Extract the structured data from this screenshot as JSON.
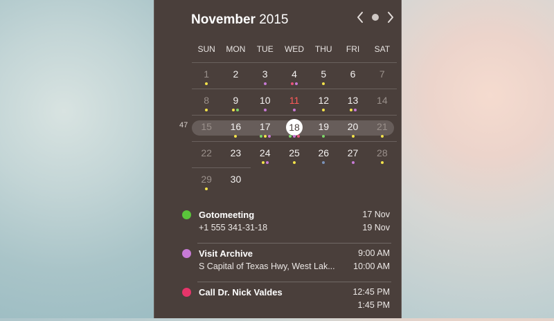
{
  "calendar": {
    "month": "November",
    "year": "2015",
    "week_number": "47",
    "weekdays": [
      "SUN",
      "MON",
      "TUE",
      "WED",
      "THU",
      "FRI",
      "SAT"
    ],
    "colors": {
      "panel_bg": "#4a3f3b",
      "event_green": "#5ac53b",
      "event_purple": "#c77ad6",
      "event_red": "#e6356a",
      "today_red": "#ff5a5a"
    }
  },
  "days": [
    {
      "d": "1",
      "muted": true
    },
    {
      "d": "2"
    },
    {
      "d": "3"
    },
    {
      "d": "4"
    },
    {
      "d": "5"
    },
    {
      "d": "6"
    },
    {
      "d": "7",
      "muted": true
    },
    {
      "d": "8",
      "muted": true
    },
    {
      "d": "9"
    },
    {
      "d": "10"
    },
    {
      "d": "11",
      "red": true
    },
    {
      "d": "12"
    },
    {
      "d": "13"
    },
    {
      "d": "14",
      "muted": true
    },
    {
      "d": "15",
      "muted": true
    },
    {
      "d": "16"
    },
    {
      "d": "17"
    },
    {
      "d": "18",
      "today": true
    },
    {
      "d": "19"
    },
    {
      "d": "20"
    },
    {
      "d": "21",
      "muted": true
    },
    {
      "d": "22",
      "muted": true
    },
    {
      "d": "23"
    },
    {
      "d": "24"
    },
    {
      "d": "25"
    },
    {
      "d": "26"
    },
    {
      "d": "27"
    },
    {
      "d": "28",
      "muted": true
    },
    {
      "d": "29",
      "muted": true
    },
    {
      "d": "30"
    }
  ],
  "events": [
    {
      "title": "Gotomeeting",
      "subtitle": "+1 555 341-31-18",
      "time_start": "17 Nov",
      "time_end": "19 Nov",
      "color": "#5ac53b"
    },
    {
      "title": "Visit Archive",
      "subtitle": "S Capital of Texas Hwy, West Lak...",
      "time_start": "9:00 AM",
      "time_end": "10:00 AM",
      "color": "#c77ad6"
    },
    {
      "title": "Call Dr. Nick Valdes",
      "subtitle": "",
      "time_start": "12:45 PM",
      "time_end": "1:45 PM",
      "color": "#e6356a"
    }
  ]
}
